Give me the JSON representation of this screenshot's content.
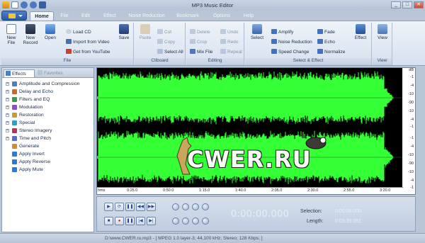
{
  "window": {
    "title": "MP3 Music Editor",
    "controls": [
      "_",
      "□",
      "✕"
    ]
  },
  "tabs": [
    {
      "label": "Home",
      "active": true
    },
    {
      "label": "File",
      "active": false
    },
    {
      "label": "Edit",
      "active": false
    },
    {
      "label": "Effect",
      "active": false
    },
    {
      "label": "Noise Reduction",
      "active": false
    },
    {
      "label": "Bookmark",
      "active": false
    },
    {
      "label": "Options",
      "active": false
    },
    {
      "label": "Help",
      "active": false
    }
  ],
  "ribbon": {
    "file": {
      "label": "File",
      "new_file": "New File",
      "new_record": "New Record",
      "open": "Open",
      "load_cd": "Load CD",
      "import_video": "Import from Video",
      "youtube": "Get from YouTube",
      "save": "Save"
    },
    "clipboard": {
      "label": "Cliboard",
      "paste": "Paste",
      "cut": "Cut",
      "copy": "Copy",
      "select_all": "Select All"
    },
    "editing": {
      "label": "Editing",
      "delete": "Delete",
      "crop": "Crop",
      "mix_file": "Mix File",
      "undo": "Undo",
      "redo": "Redo",
      "repeat": "Repeat"
    },
    "select_effect": {
      "label": "Select & Effect",
      "select": "Select",
      "amplify": "Amplify",
      "noise_reduction": "Noise Reduction",
      "speed_change": "Speed Change",
      "fade": "Fade",
      "echo": "Echo",
      "normalize": "Normalize",
      "effect": "Effect"
    },
    "view": {
      "label": "View",
      "view": "View"
    }
  },
  "left_panel": {
    "tabs": [
      {
        "label": "Effects",
        "active": true
      },
      {
        "label": "Favorites",
        "active": false
      }
    ],
    "tree": [
      {
        "label": "Amplitude and Compression",
        "expandable": true,
        "color": "#4a7fc4"
      },
      {
        "label": "Delay and Echo",
        "expandable": true,
        "color": "#c46b2e"
      },
      {
        "label": "Filters and EQ",
        "expandable": true,
        "color": "#3a9b4a"
      },
      {
        "label": "Modulation",
        "expandable": true,
        "color": "#8a4fc4"
      },
      {
        "label": "Restoration",
        "expandable": true,
        "color": "#c4a02e"
      },
      {
        "label": "Special",
        "expandable": true,
        "color": "#2ea0c4"
      },
      {
        "label": "Stereo Imagery",
        "expandable": true,
        "color": "#c42e5a"
      },
      {
        "label": "Time and Pitch",
        "expandable": true,
        "color": "#5a6fc4"
      },
      {
        "label": "Generate",
        "expandable": false,
        "color": "#d68a2a"
      },
      {
        "label": "Apply Invert",
        "expandable": false,
        "color": "#2a7ad6"
      },
      {
        "label": "Apply Reverse",
        "expandable": false,
        "color": "#2a7ad6"
      },
      {
        "label": "Apply Mute",
        "expandable": false,
        "color": "#2a7ad6"
      }
    ]
  },
  "waveform": {
    "color": "#35ff35",
    "db_label": "dB",
    "db_ticks": [
      "-1",
      "-4",
      "-10",
      "-90",
      "-10",
      "-4",
      "-1"
    ],
    "timeline": [
      "hms",
      "0:25.0",
      "0:50.0",
      "1:15.0",
      "1:40.0",
      "2:05.0",
      "2:30.0",
      "2:55.0",
      "3:20.0"
    ]
  },
  "transport": {
    "time": "0:00:00.000",
    "selection_label": "Selection:",
    "length_label": "Length:",
    "selection_value": "0:00:00.000",
    "length_value": "0:03:35.051"
  },
  "status": {
    "text": "D:\\www.CWER.ru.mp3 - [ MPEG 1.0 layer-3; 44,100 kHz; Stereo; 128 Kbps; ]"
  },
  "watermark": {
    "text": "CWER.RU"
  }
}
